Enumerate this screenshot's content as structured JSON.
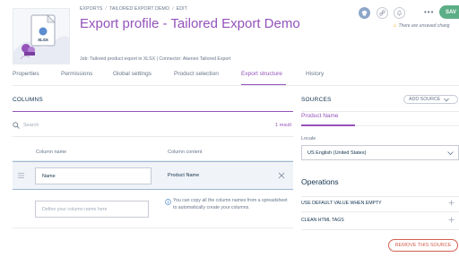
{
  "breadcrumb": {
    "items": [
      "EXPORTS",
      "TAILORED EXPORT DEMO",
      "EDIT"
    ]
  },
  "profile": {
    "title": "Export profile - Tailored Export Demo",
    "subline": "Job: Tailored product export in XLSX | Connector: Akeneo Tailored Export",
    "thumbnail_format": "XLSX"
  },
  "header_actions": {
    "save_label": "SAV",
    "unsaved_message": "There are unsaved chang",
    "more_label": "•••"
  },
  "tabs": [
    {
      "label": "Properties",
      "active": false
    },
    {
      "label": "Permissions",
      "active": false
    },
    {
      "label": "Global settings",
      "active": false
    },
    {
      "label": "Product selection",
      "active": false
    },
    {
      "label": "Export structure",
      "active": true
    },
    {
      "label": "History",
      "active": false
    }
  ],
  "columns_panel": {
    "title": "COLUMNS",
    "search_placeholder": "Search",
    "result_count": "1 result",
    "headers": {
      "name": "Column name",
      "content": "Column content"
    },
    "rows": [
      {
        "name": "Name",
        "content": "Product Name"
      }
    ],
    "new_column_placeholder": "Define your column name here",
    "hint": "You can copy all the column names from a spreadsheet to automatically create your columns."
  },
  "sources_panel": {
    "title": "SOURCES",
    "add_source_label": "ADD SOURCE",
    "active_source": "Product Name",
    "locale_label": "Locale",
    "locale_value": "US English (United States)",
    "operations_title": "Operations",
    "operations": [
      "USE DEFAULT VALUE WHEN EMPTY",
      "CLEAN HTML TAGS"
    ],
    "remove_label": "REMOVE THIS SOURCE"
  },
  "colors": {
    "accent": "#9452ba",
    "save": "#5cae86",
    "danger": "#d4604f",
    "warning": "#f9b53f",
    "selected_row": "#f0f3f8",
    "text": "#67768a",
    "text_dark": "#11324d"
  }
}
